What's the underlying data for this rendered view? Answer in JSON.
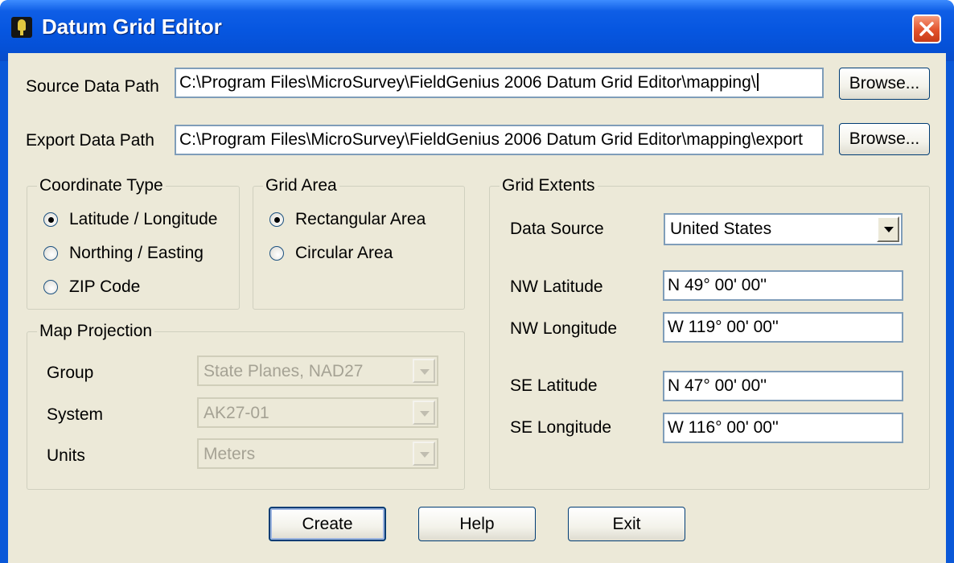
{
  "window": {
    "title": "Datum Grid Editor"
  },
  "paths": {
    "source_label": "Source Data Path",
    "source_value": "C:\\Program Files\\MicroSurvey\\FieldGenius 2006 Datum Grid Editor\\mapping\\",
    "export_label": "Export Data Path",
    "export_value": "C:\\Program Files\\MicroSurvey\\FieldGenius 2006 Datum Grid Editor\\mapping\\export",
    "browse_label": "Browse..."
  },
  "coordinate_type": {
    "title": "Coordinate Type",
    "options": [
      "Latitude / Longitude",
      "Northing / Easting",
      "ZIP Code"
    ],
    "selected": "Latitude / Longitude"
  },
  "grid_area": {
    "title": "Grid Area",
    "options": [
      "Rectangular Area",
      "Circular Area"
    ],
    "selected": "Rectangular Area"
  },
  "map_projection": {
    "title": "Map Projection",
    "group_label": "Group",
    "group_value": "State Planes, NAD27",
    "system_label": "System",
    "system_value": "AK27-01",
    "units_label": "Units",
    "units_value": "Meters"
  },
  "grid_extents": {
    "title": "Grid Extents",
    "data_source_label": "Data Source",
    "data_source_value": "United States",
    "nw_lat_label": "NW Latitude",
    "nw_lat_value": "N 49° 00' 00''",
    "nw_lon_label": "NW Longitude",
    "nw_lon_value": "W 119° 00' 00''",
    "se_lat_label": "SE Latitude",
    "se_lat_value": "N 47° 00' 00''",
    "se_lon_label": "SE Longitude",
    "se_lon_value": "W 116° 00' 00''"
  },
  "buttons": {
    "create": "Create",
    "help": "Help",
    "exit": "Exit"
  },
  "colors": {
    "titlebar": "#0656e0",
    "dialog_bg": "#ece9d8",
    "close_button": "#e2522c"
  }
}
